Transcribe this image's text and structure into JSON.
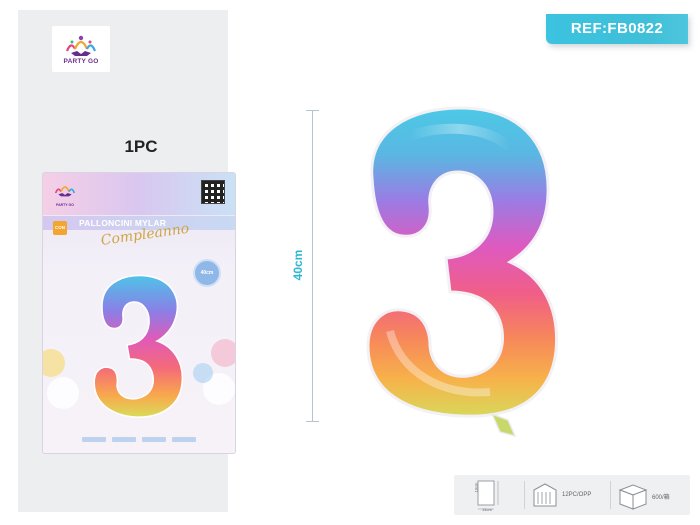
{
  "brand": {
    "name": "PARTY GO"
  },
  "quantity_label": "1PC",
  "package": {
    "title": "PALLONCINI MYLAR",
    "script_text": "Compleanno",
    "size_badge": "40cm",
    "con_badge": "CON"
  },
  "ref_label": "REF:FB0822",
  "measure_label": "40cm",
  "product": {
    "digit": "3"
  },
  "info": {
    "size_w": "14cm",
    "size_h": "19cm",
    "pack_label": "12PC/OPP",
    "carton_label": "600/箱"
  },
  "colors": {
    "accent": "#3cc3e0",
    "panel": "#eceef0",
    "measure_text": "#2fb6d3"
  },
  "icons": [
    "brand-logo-icon",
    "qr-code-icon",
    "bag-size-icon",
    "opp-bag-icon",
    "carton-box-icon"
  ]
}
